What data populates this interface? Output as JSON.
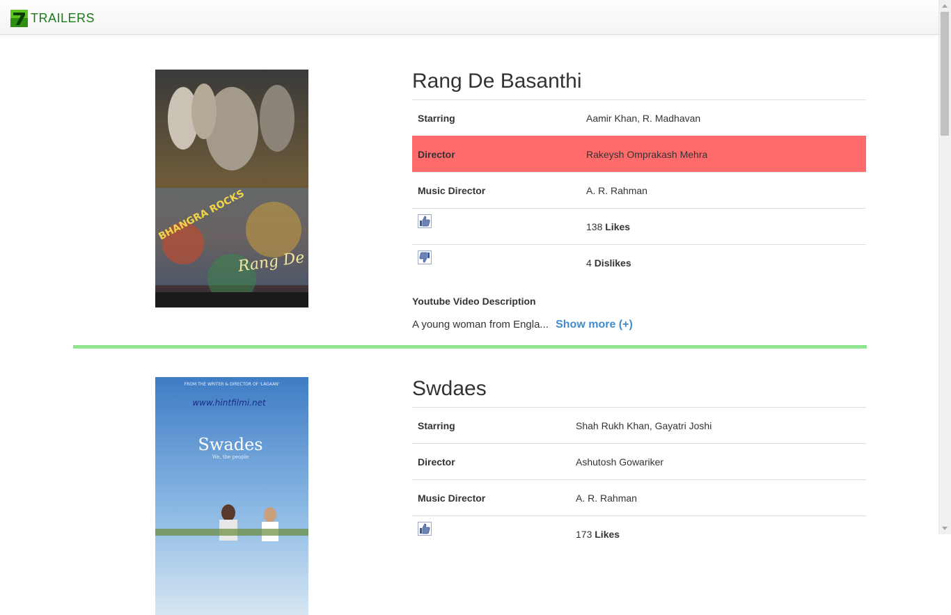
{
  "brand": {
    "text": "TRAILERS"
  },
  "movies": [
    {
      "title": "Rang De Basanthi",
      "poster": {
        "tagline": "BHANGRA ROCKS",
        "title": "Rang De Basanti"
      },
      "rows": {
        "starring": {
          "label": "Starring",
          "value": "Aamir Khan, R. Madhavan"
        },
        "director": {
          "label": "Director",
          "value": "Rakeysh Omprakash Mehra"
        },
        "music": {
          "label": "Music Director",
          "value": "A. R. Rahman"
        }
      },
      "likes": {
        "count": "138",
        "label": "Likes"
      },
      "dislikes": {
        "count": "4",
        "label": "Dislikes"
      },
      "description_heading": "Youtube Video Description",
      "description": "A young woman from Engla...",
      "show_more": "Show more (+)"
    },
    {
      "title": "Swdaes",
      "poster": {
        "top_line": "FROM THE WRITER & DIRECTOR OF 'LAGAAN'",
        "url": "www.hintfilmi.net",
        "title": "Swades",
        "subtitle": "We, the people"
      },
      "rows": {
        "starring": {
          "label": "Starring",
          "value": "Shah Rukh Khan, Gayatri Joshi"
        },
        "director": {
          "label": "Director",
          "value": "Ashutosh Gowariker"
        },
        "music": {
          "label": "Music Director",
          "value": "A. R. Rahman"
        }
      },
      "likes": {
        "count": "173",
        "label": "Likes"
      }
    }
  ],
  "colors": {
    "brand": "#1a7a1a",
    "highlight_row": "#ff6b6b",
    "divider": "#8ee58e",
    "link": "#428bca"
  }
}
